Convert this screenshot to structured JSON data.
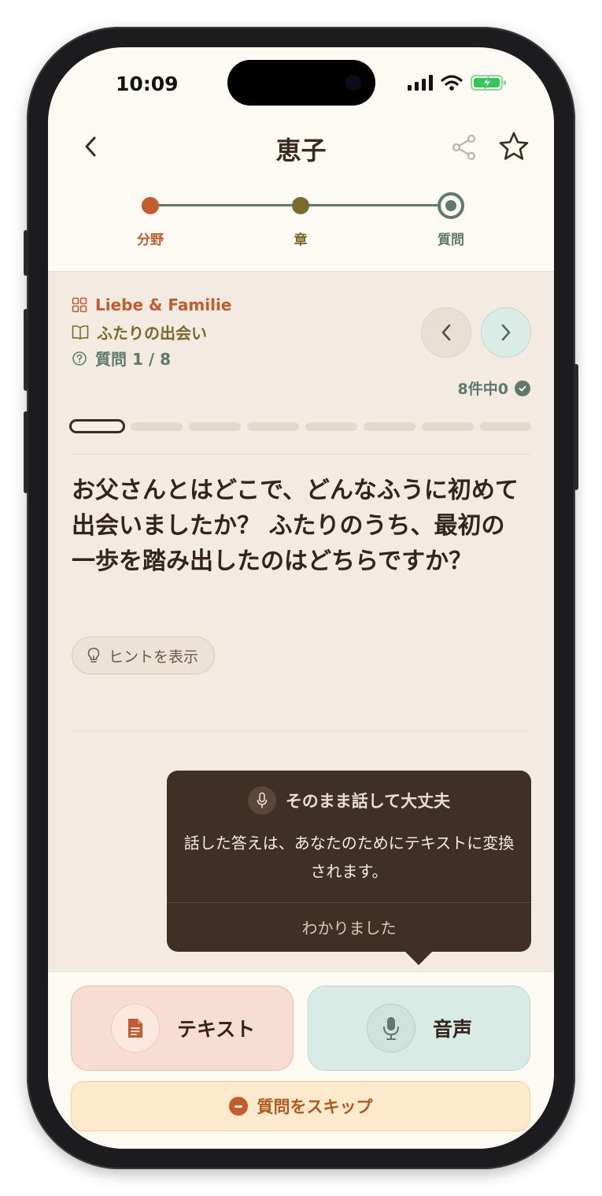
{
  "status_bar": {
    "time": "10:09"
  },
  "header": {
    "title": "恵子"
  },
  "stepper": {
    "steps": [
      {
        "label": "分野",
        "color": "#c25b2e"
      },
      {
        "label": "章",
        "color": "#7a6a2e"
      },
      {
        "label": "質問",
        "color": "#5e7a6e"
      }
    ]
  },
  "meta": {
    "category": "Liebe & Familie",
    "chapter": "ふたりの出会い",
    "question_counter": "質問 1 / 8",
    "answered": "8件中0"
  },
  "progress": {
    "total_segments": 8,
    "current_index": 0
  },
  "question": {
    "text": "お父さんとはどこで、どんなふうに初めて出会いましたか？ ふたりのうち、最初の一歩を踏み出したのはどちらですか？"
  },
  "hint": {
    "label": "ヒントを表示"
  },
  "tooltip": {
    "title": "そのまま話して大丈夫",
    "body": "話した答えは、あなたのためにテキストに変換されます。",
    "ok_label": "わかりました"
  },
  "answer_modes": {
    "text_label": "テキスト",
    "voice_label": "音声"
  },
  "skip": {
    "label": "質問をスキップ"
  },
  "colors": {
    "accent_terracotta": "#c25b2e",
    "accent_olive": "#7a6a2e",
    "accent_sage": "#5e7a6e",
    "text_dark": "#33241c"
  }
}
